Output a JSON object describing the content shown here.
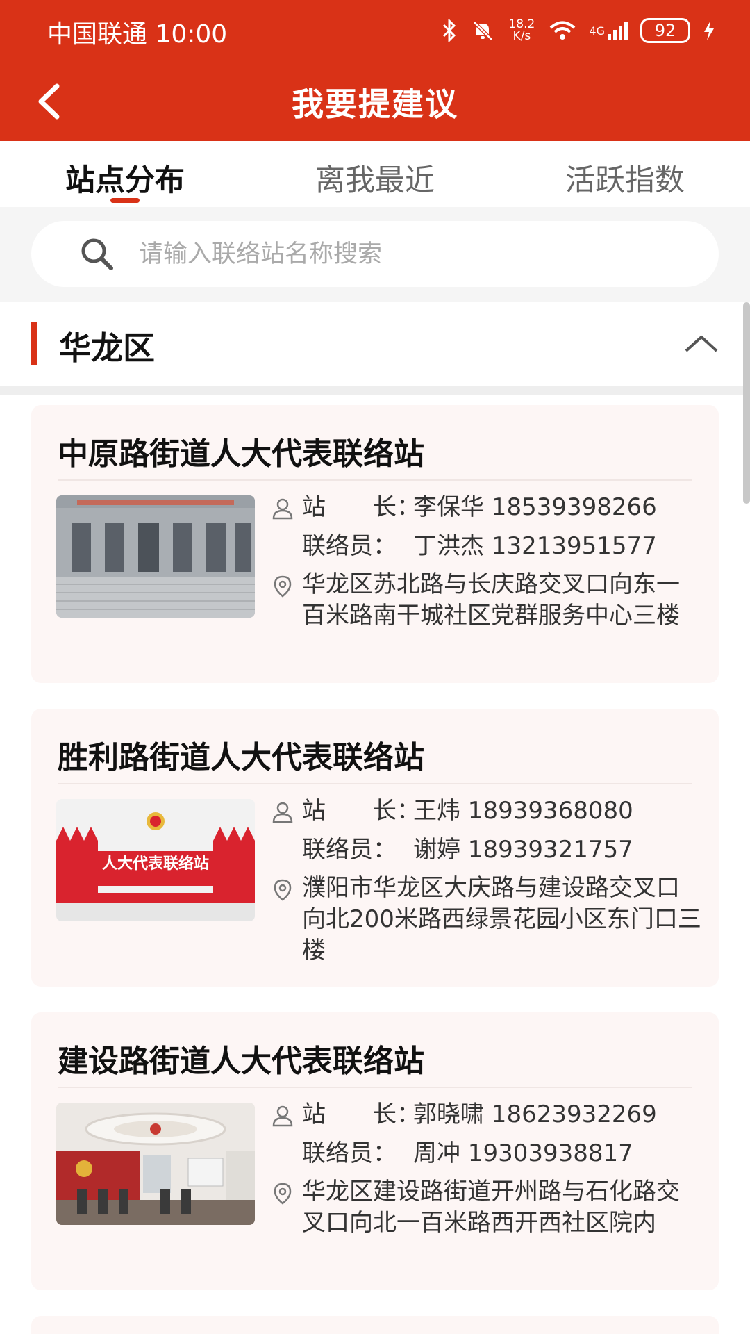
{
  "status_bar": {
    "carrier_time": "中国联通 10:00",
    "net_speed_top": "18.2",
    "net_speed_bottom": "K/s",
    "network": "4G",
    "battery": "92"
  },
  "navbar": {
    "title": "我要提建议"
  },
  "tabs": [
    {
      "label": "站点分布",
      "active": true
    },
    {
      "label": "离我最近",
      "active": false
    },
    {
      "label": "活跃指数",
      "active": false
    }
  ],
  "search": {
    "placeholder": "请输入联络站名称搜索",
    "value": ""
  },
  "district": {
    "name": "华龙区"
  },
  "stations": [
    {
      "name": "中原路街道人大代表联络站",
      "director_label": "站　　长：",
      "director": "李保华 18539398266",
      "contact_label": "联络员：",
      "contact": "丁洪杰 13213951577",
      "address": "华龙区苏北路与长庆路交叉口向东一百米路南干城社区党群服务中心三楼"
    },
    {
      "name": "胜利路街道人大代表联络站",
      "director_label": "站　　长：",
      "director": "王炜 18939368080",
      "contact_label": "联络员：",
      "contact": "谢婷 18939321757",
      "address": "濮阳市华龙区大庆路与建设路交叉口向北200米路西绿景花园小区东门口三楼"
    },
    {
      "name": "建设路街道人大代表联络站",
      "director_label": "站　　长：",
      "director": "郭晓啸 18623932269",
      "contact_label": "联络员：",
      "contact": "周冲 19303938817",
      "address": "华龙区建设路街道开州路与石化路交叉口向北一百米路西开西社区院内"
    }
  ],
  "photo_texts": {
    "station2_sign": "人大代表联络站"
  },
  "colors": {
    "brand_red": "#d93217",
    "card_bg": "#fdf6f5"
  }
}
